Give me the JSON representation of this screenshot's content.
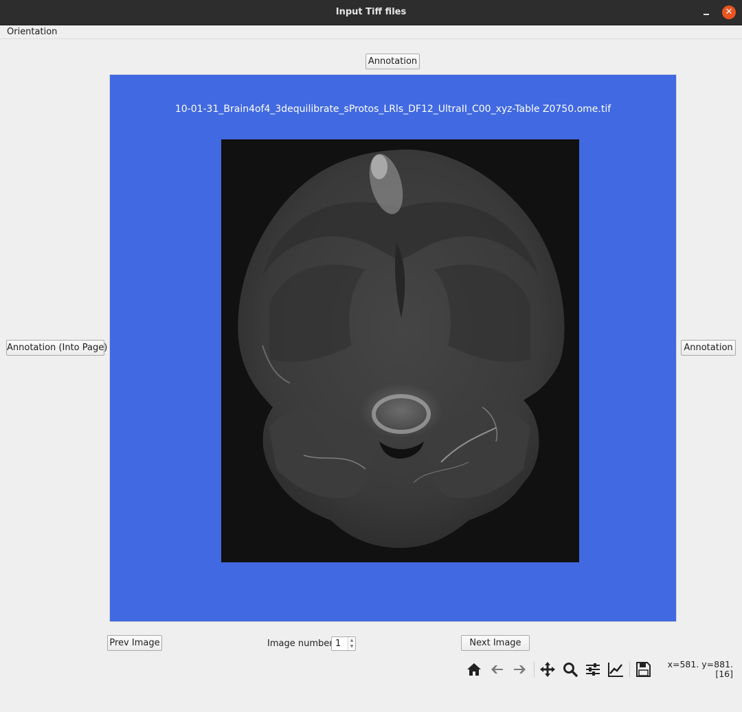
{
  "window": {
    "title": "Input Tiff files"
  },
  "menu": {
    "orientation": "Orientation"
  },
  "buttons": {
    "annotation_top": "Annotation",
    "annotation_left": "Annotation (Into Page)",
    "annotation_right": "Annotation",
    "prev": "Prev Image",
    "next": "Next Image"
  },
  "canvas": {
    "image_title": "10-01-31_Brain4of4_3dequilibrate_sProtos_LRls_DF12_UltraII_C00_xyz-Table Z0750.ome.tif",
    "background_color": "#4169e1"
  },
  "image_number": {
    "label": "Image number",
    "value": "1"
  },
  "toolbar": {
    "icons": [
      "home-icon",
      "back-arrow-icon",
      "forward-arrow-icon",
      "pan-icon",
      "zoom-icon",
      "configure-subplots-icon",
      "edit-curves-icon",
      "save-icon"
    ]
  },
  "status": {
    "coords_line1": "x=581. y=881.",
    "coords_line2": "[16]"
  }
}
